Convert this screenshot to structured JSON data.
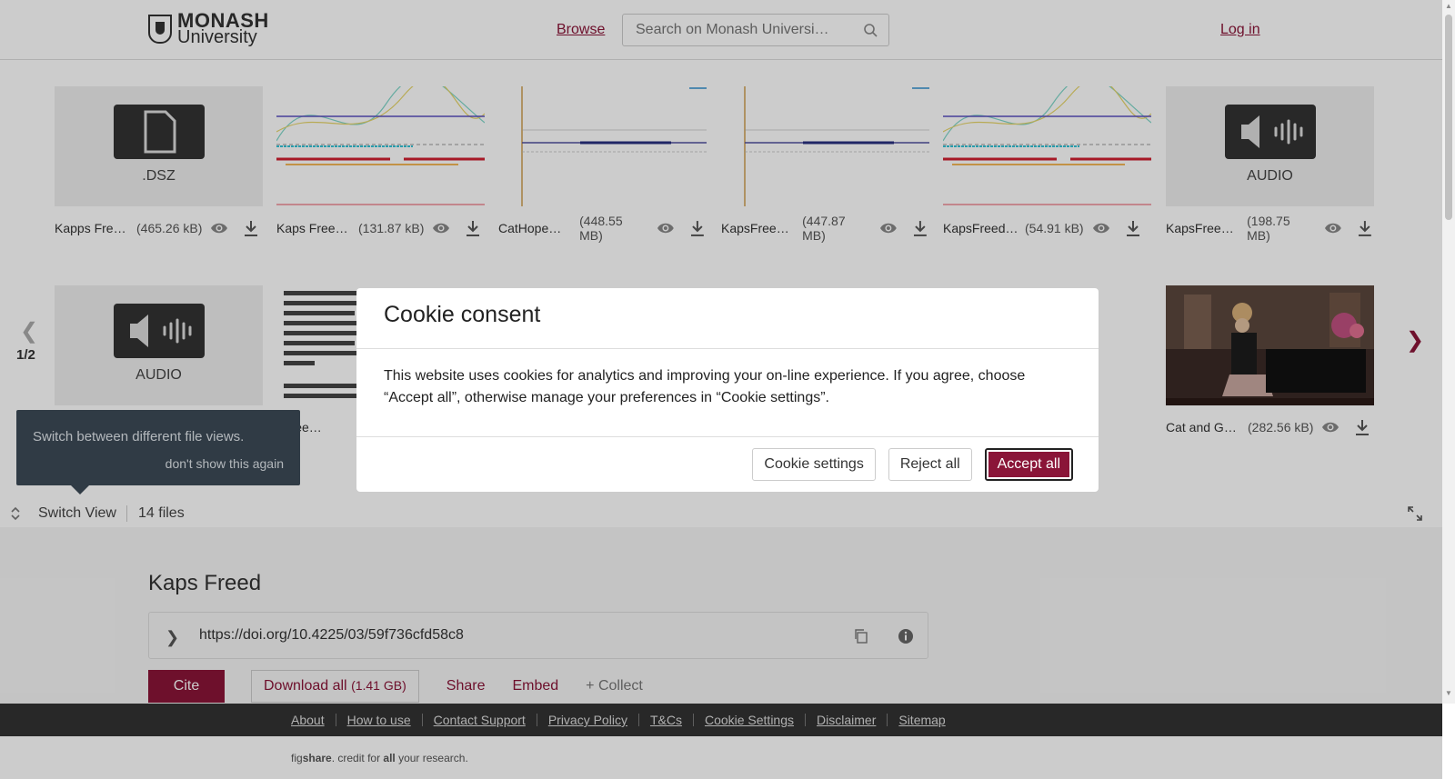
{
  "header": {
    "logo_line1": "MONASH",
    "logo_line2": "University",
    "browse": "Browse",
    "search_placeholder": "Search on Monash Universi…",
    "login": "Log in"
  },
  "gallery": {
    "page_indicator": "1/2",
    "row1": [
      {
        "name": "Kapps Fre…",
        "size": "(465.26 kB)",
        "thumb": "file-tile",
        "tile_label": ".DSZ"
      },
      {
        "name": "Kaps Free…",
        "size": "(131.87 kB)",
        "thumb": "graph"
      },
      {
        "name": "CatHope…",
        "size": "(448.55 MB)",
        "thumb": "score-lines"
      },
      {
        "name": "KapsFree…",
        "size": "(447.87 MB)",
        "thumb": "score-lines"
      },
      {
        "name": "KapsFreed…",
        "size": "(54.91 kB)",
        "thumb": "graph"
      },
      {
        "name": "KapsFree…",
        "size": "(198.75 MB)",
        "thumb": "audio-tile",
        "tile_label": "AUDIO"
      }
    ],
    "row2": [
      {
        "name": "",
        "size": "",
        "thumb": "audio-tile",
        "tile_label": "AUDIO"
      },
      {
        "name": "sFree…",
        "size": "",
        "thumb": "text-doc"
      },
      {
        "name": "Cat and G…",
        "size": "(282.56 kB)",
        "thumb": "photo"
      }
    ],
    "tooltip": {
      "message": "Switch between different file views.",
      "dismiss": "don't show this again"
    },
    "switch_view": "Switch View",
    "file_count": "14 files"
  },
  "item": {
    "title": "Kaps Freed",
    "doi": "https://doi.org/10.4225/03/59f736cfd58c8",
    "cite": "Cite",
    "download_all": "Download all",
    "download_size": "(1.41 GB)",
    "share": "Share",
    "embed": "Embed",
    "collect": "+ Collect"
  },
  "footer": {
    "links": [
      "About",
      "How to use",
      "Contact Support",
      "Privacy Policy",
      "T&Cs",
      "Cookie Settings",
      "Disclaimer",
      "Sitemap"
    ],
    "credit_pre": "fig",
    "credit_brand": "share",
    "credit_mid": ". credit for ",
    "credit_all": "all",
    "credit_post": " your research."
  },
  "cookie_modal": {
    "title": "Cookie consent",
    "body": "This website uses cookies for analytics and improving your on-line experience. If you agree, choose “Accept all”, otherwise manage your preferences in “Cookie settings”.",
    "settings_btn": "Cookie settings",
    "reject_btn": "Reject all",
    "accept_btn": "Accept all"
  },
  "colors": {
    "brand": "#8a1538",
    "footer_bg": "#333333",
    "tooltip_bg": "#3d4a57"
  }
}
